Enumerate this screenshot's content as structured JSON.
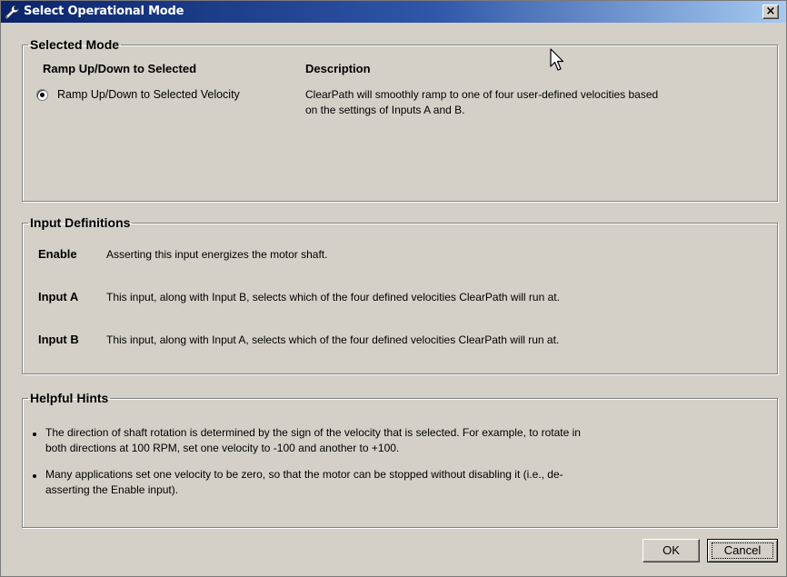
{
  "window": {
    "title": "Select Operational Mode",
    "close_label": "×"
  },
  "selected_mode": {
    "legend": "Selected Mode",
    "column_header": "Ramp Up/Down to Selected",
    "option_label": "Ramp Up/Down to Selected Velocity",
    "option_selected": true,
    "description_header": "Description",
    "description_line1": "ClearPath will smoothly ramp to one of four user-defined velocities based",
    "description_line2": "on the settings of Inputs A and B."
  },
  "input_definitions": {
    "legend": "Input Definitions",
    "items": [
      {
        "name": "Enable",
        "text": "Asserting this input energizes the motor shaft."
      },
      {
        "name": "Input A",
        "text": "This input, along with Input B, selects which of the four defined velocities ClearPath will run at."
      },
      {
        "name": "Input B",
        "text": "This input, along with Input A, selects which of the four defined velocities ClearPath will run at."
      }
    ]
  },
  "helpful_hints": {
    "legend": "Helpful Hints",
    "hints": [
      {
        "line1": "The direction of shaft rotation is determined by the sign of the velocity that is selected. For example, to rotate in",
        "line2": "both directions at 100 RPM, set one velocity to -100 and another to +100."
      },
      {
        "line1": "Many applications set one velocity to be zero, so that the motor can be stopped without disabling it (i.e., de-",
        "line2": "asserting the Enable input)."
      }
    ]
  },
  "buttons": {
    "ok": "OK",
    "cancel": "Cancel"
  },
  "colors": {
    "titlebar_start": "#0a246a",
    "titlebar_end": "#a6caf0",
    "dialog_face": "#d4d0c8"
  },
  "icons": {
    "title": "wrench-icon",
    "pointer": "mouse-pointer-icon"
  }
}
